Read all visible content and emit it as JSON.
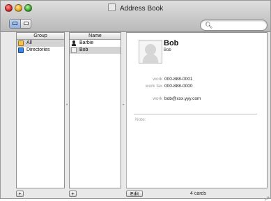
{
  "window": {
    "title": "Address Book",
    "buttons": {
      "close": "close",
      "minimize": "minimize",
      "zoom": "zoom"
    }
  },
  "toolbar": {
    "view_toggle": {
      "left": "card-and-columns-view",
      "right": "card-only-view"
    },
    "search": {
      "icon": "search-icon",
      "value": "",
      "placeholder": ""
    }
  },
  "group_column": {
    "header": "Group",
    "items": [
      {
        "label": "All",
        "icon": "all-group-icon",
        "selected": true
      },
      {
        "label": "Directories",
        "icon": "directories-icon",
        "selected": false
      }
    ],
    "add_label": "+"
  },
  "name_column": {
    "header": "Name",
    "items": [
      {
        "label": "Barbie",
        "icon": "person-icon",
        "selected": false
      },
      {
        "label": "Bob",
        "icon": "vcard-icon",
        "selected": true
      }
    ],
    "add_label": "+"
  },
  "card": {
    "name": "Bob",
    "subtitle": "Bob",
    "fields": [
      {
        "label": "work",
        "value": "000-888-0001"
      },
      {
        "label": "work fax",
        "value": "000-888-0000"
      },
      {
        "label": "work",
        "value": "bob@xxx.yyy.com"
      }
    ],
    "note_label": "Note:",
    "edit_label": "Edit",
    "count": "4 cards"
  }
}
